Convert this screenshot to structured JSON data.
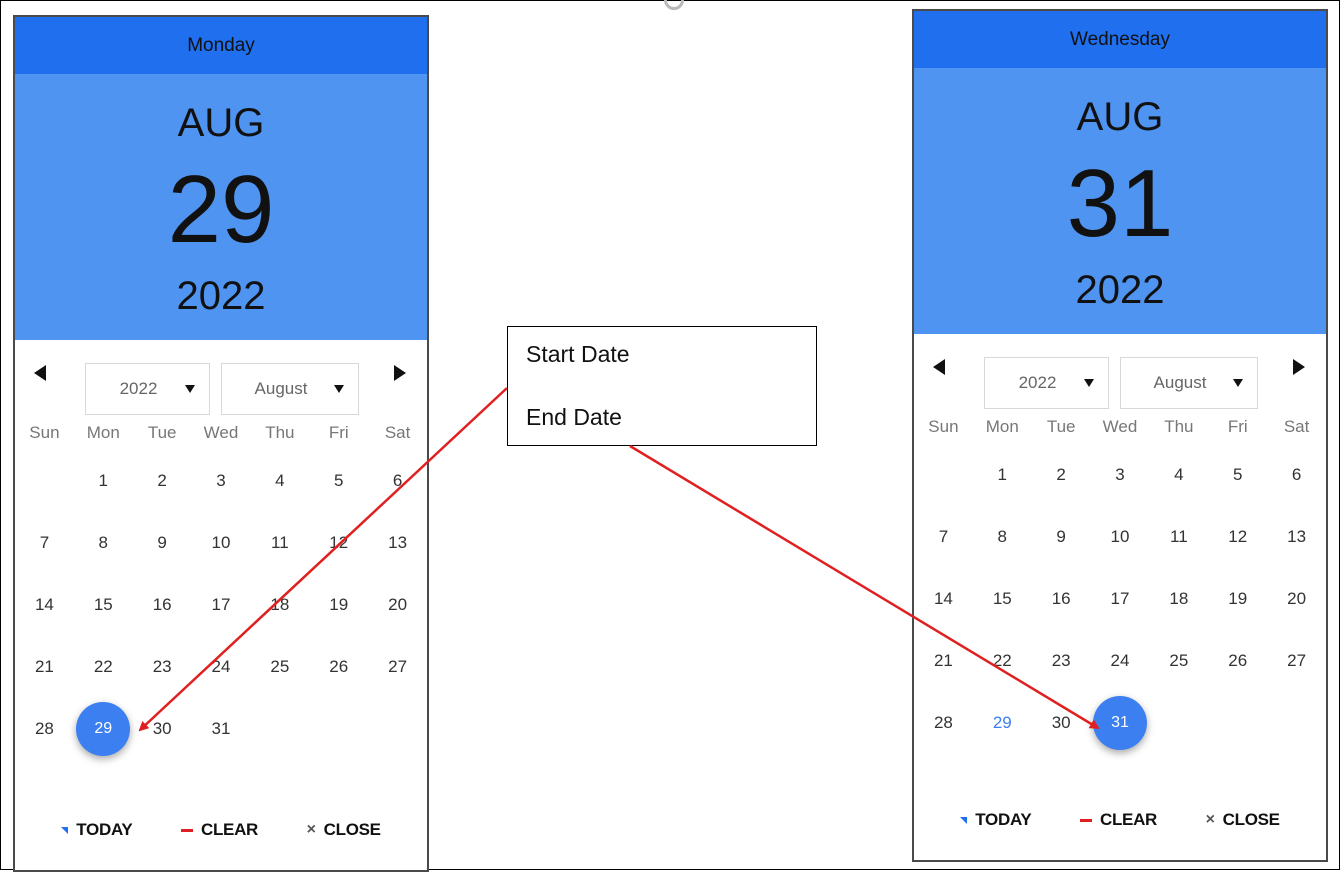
{
  "colors": {
    "header_dark_blue": "#1f6fef",
    "header_light_blue": "#5094f2",
    "selected_day": "#3c7ff0",
    "arrow_red": "#e02020"
  },
  "pickers": [
    {
      "weekday": "Monday",
      "month_abbr": "AUG",
      "day": "29",
      "year": "2022",
      "year_select": "2022",
      "month_select": "August",
      "dow": [
        "Sun",
        "Mon",
        "Tue",
        "Wed",
        "Thu",
        "Fri",
        "Sat"
      ],
      "weeks": [
        [
          "",
          "1",
          "2",
          "3",
          "4",
          "5",
          "6"
        ],
        [
          "7",
          "8",
          "9",
          "10",
          "11",
          "12",
          "13"
        ],
        [
          "14",
          "15",
          "16",
          "17",
          "18",
          "19",
          "20"
        ],
        [
          "21",
          "22",
          "23",
          "24",
          "25",
          "26",
          "27"
        ],
        [
          "28",
          "29",
          "30",
          "31",
          "",
          "",
          ""
        ]
      ],
      "selected_day": "29",
      "highlight_day": "",
      "buttons": {
        "today": "TODAY",
        "clear": "CLEAR",
        "close": "CLOSE"
      },
      "icons": {
        "prev": "triangle-left-icon",
        "next": "triangle-right-icon",
        "caret": "caret-down-icon"
      }
    },
    {
      "weekday": "Wednesday",
      "month_abbr": "AUG",
      "day": "31",
      "year": "2022",
      "year_select": "2022",
      "month_select": "August",
      "dow": [
        "Sun",
        "Mon",
        "Tue",
        "Wed",
        "Thu",
        "Fri",
        "Sat"
      ],
      "weeks": [
        [
          "",
          "1",
          "2",
          "3",
          "4",
          "5",
          "6"
        ],
        [
          "7",
          "8",
          "9",
          "10",
          "11",
          "12",
          "13"
        ],
        [
          "14",
          "15",
          "16",
          "17",
          "18",
          "19",
          "20"
        ],
        [
          "21",
          "22",
          "23",
          "24",
          "25",
          "26",
          "27"
        ],
        [
          "28",
          "29",
          "30",
          "31",
          "",
          "",
          ""
        ]
      ],
      "selected_day": "31",
      "highlight_day": "29",
      "buttons": {
        "today": "TODAY",
        "clear": "CLEAR",
        "close": "CLOSE"
      },
      "icons": {
        "prev": "triangle-left-icon",
        "next": "triangle-right-icon",
        "caret": "caret-down-icon"
      }
    }
  ],
  "callout": {
    "start_label": "Start Date",
    "end_label": "End Date"
  }
}
